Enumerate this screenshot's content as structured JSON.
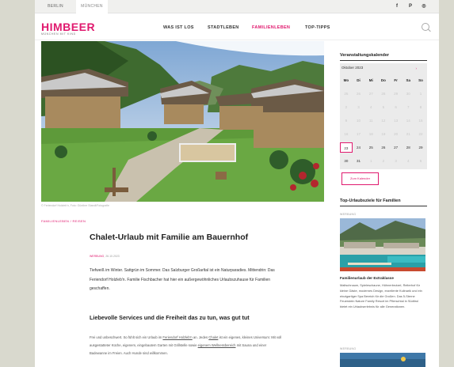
{
  "topbar": {
    "cities": [
      "BERLIN",
      "MÜNCHEN"
    ],
    "active_city": "MÜNCHEN",
    "social": [
      {
        "icon": "facebook-icon",
        "glyph": "f"
      },
      {
        "icon": "pinterest-icon",
        "glyph": "P"
      },
      {
        "icon": "instagram-icon",
        "glyph": "◎"
      }
    ]
  },
  "header": {
    "logo": "HIMBEER",
    "logo_sub": "MÜNCHEN MIT KIND",
    "nav": [
      "WAS IST LOS",
      "STADTLEBEN",
      "FAMILIENLEBEN",
      "TOP-TIPPS"
    ],
    "active_nav": "FAMILIENLEBEN"
  },
  "article": {
    "image_caption": "© Feriendorf Holzleb'n, Foto: Günther Standl/Fotografie",
    "category": "FAMILIENLEBEN / REISEN",
    "title": "Chalet-Urlaub mit Familie am Bauernhof",
    "meta_tag": "WERBUNG",
    "meta_date": "26.10.2023",
    "intro": "Tiefweiß im Winter. Sattgrün im Sommer. Das Salzburger Großarltal ist ein Naturparadies. Mittendrin: Das Feriendorf Holzleb'n. Familie Fischbacher hat hier ein außergewöhnliches Urlaubszuhause für Familien geschaffen.",
    "subhead": "Liebevolle Services und die Freiheit das zu tun, was gut tut",
    "body_1": "Frei und unbeschwert. So fühlt sich ein Urlaub im",
    "body_link_1": "Feriendorf Holzleb'n",
    "body_2": "an. Jedes",
    "body_link_2": "Chalet",
    "body_3": "ist ein eigenes, kleines Universum: Mit voll ausgestatteter Küche, eigenem, eingebautem Garten mit Grillstelle sowie",
    "body_link_3": "eigenem Wellnessbereich",
    "body_4": "mit Sauna und einer Badewanne im Freien. Auch Hunde sind willkommen."
  },
  "calendar": {
    "title": "Veranstaltungskalender",
    "month": "Oktober 2023",
    "next_arrow": "›",
    "weekdays": [
      "Mo",
      "Di",
      "Mi",
      "Do",
      "Fr",
      "Sa",
      "So"
    ],
    "weeks": [
      [
        "25",
        "26",
        "27",
        "28",
        "29",
        "30",
        "1"
      ],
      [
        "2",
        "3",
        "4",
        "5",
        "6",
        "7",
        "8"
      ],
      [
        "9",
        "10",
        "11",
        "12",
        "13",
        "14",
        "15"
      ],
      [
        "16",
        "17",
        "18",
        "19",
        "20",
        "21",
        "22"
      ],
      [
        "23",
        "24",
        "25",
        "26",
        "27",
        "28",
        "29"
      ],
      [
        "30",
        "31",
        "1",
        "2",
        "3",
        "4",
        "5"
      ]
    ],
    "today": "23",
    "button": "Zum Kalender"
  },
  "sidebar_section": {
    "title": "Top-Urlaubsziele für Familien",
    "card1": {
      "caption": "WERBUNG",
      "title": "Familienurlaub der Extraklasse",
      "text": "Maltschnaum, Spieleschaune, Hühnerbrutzel, Reiterhof für kleine Gäste, modernes Design, exzellente Kulinarik und ein einzigartiger Spa Bereich für die Großen. Das 5-Sterne Feuerstein Nature Family Resort im Pflerschtal in Südtirol bietet ein Urlaubserlebnis für alle Generationen."
    },
    "card2": {
      "caption": "WERBUNG"
    }
  },
  "colors": {
    "brand": "#e0196e",
    "background": "#d9d9ce"
  }
}
